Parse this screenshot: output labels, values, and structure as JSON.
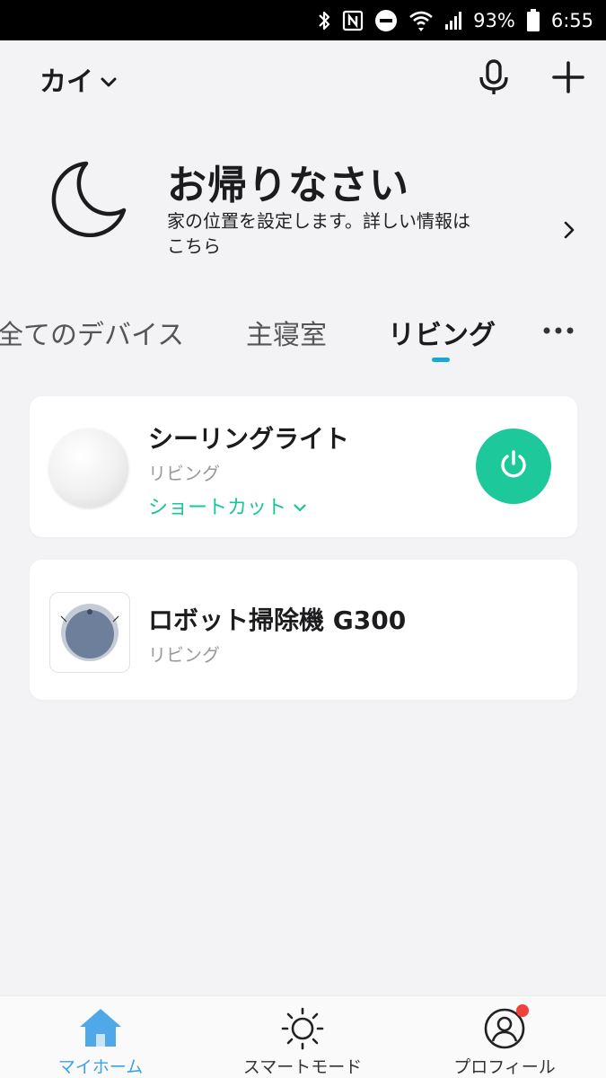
{
  "status_bar": {
    "battery": "93%",
    "time": "6:55",
    "icons": [
      "bluetooth-icon",
      "nfc-icon",
      "dnd-icon",
      "wifi-icon",
      "signal-icon",
      "battery-icon"
    ]
  },
  "header": {
    "home_name": "カイ",
    "mic_icon": "microphone-icon",
    "add_icon": "plus-icon"
  },
  "welcome": {
    "title": "お帰りなさい",
    "subtitle": "家の位置を設定します。詳しい情報はこちら",
    "icon": "moon-icon"
  },
  "tabs": {
    "items": [
      {
        "label": "全てのデバイス"
      },
      {
        "label": "主寝室"
      },
      {
        "label": "リビング"
      }
    ],
    "active_index": 2,
    "more_icon": "more-horizontal-icon"
  },
  "devices": [
    {
      "name": "シーリングライト",
      "room": "リビング",
      "shortcut_label": "ショートカット",
      "power_on": true
    },
    {
      "name": "ロボット掃除機 G300",
      "room": "リビング"
    }
  ],
  "bottom_nav": {
    "items": [
      {
        "label": "マイホーム",
        "icon": "home-icon"
      },
      {
        "label": "スマートモード",
        "icon": "sun-icon"
      },
      {
        "label": "プロフィール",
        "icon": "profile-icon"
      }
    ],
    "active_index": 0
  },
  "colors": {
    "accent_green": "#1dc99a",
    "accent_blue": "#19a7d6",
    "nav_active": "#3aa3e6",
    "notification": "#f0423a"
  }
}
